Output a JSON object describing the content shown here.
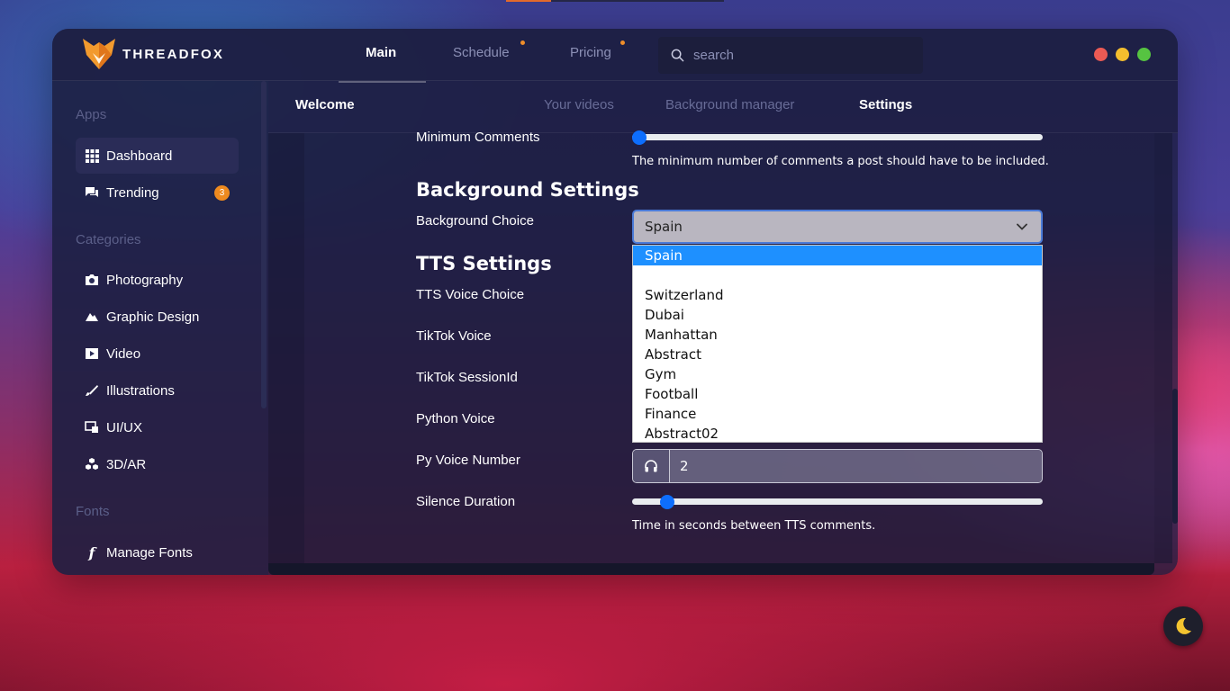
{
  "brand": {
    "name": "THREADFOX",
    "accent": "#ef8d2a"
  },
  "nav": {
    "tabs": [
      {
        "label": "Main",
        "active": true
      },
      {
        "label": "Schedule",
        "dot": true
      },
      {
        "label": "Pricing",
        "dot": true
      }
    ]
  },
  "search": {
    "placeholder": "search",
    "value": ""
  },
  "window_controls": {
    "close": "#ec5a54",
    "minimize": "#f4be2e",
    "maximize": "#56c341"
  },
  "sidebar": {
    "apps_heading": "Apps",
    "apps": [
      {
        "label": "Dashboard",
        "icon": "grid-icon",
        "active": true
      },
      {
        "label": "Trending",
        "icon": "chat-icon",
        "badge": "3"
      }
    ],
    "categories_heading": "Categories",
    "categories": [
      {
        "label": "Photography",
        "icon": "camera-icon"
      },
      {
        "label": "Graphic Design",
        "icon": "pen-nib-icon"
      },
      {
        "label": "Video",
        "icon": "video-icon"
      },
      {
        "label": "Illustrations",
        "icon": "brush-icon"
      },
      {
        "label": "UI/UX",
        "icon": "layout-icon"
      },
      {
        "label": "3D/AR",
        "icon": "cubes-icon"
      }
    ],
    "fonts_heading": "Fonts",
    "fonts": [
      {
        "label": "Manage Fonts",
        "icon": "font-f-icon"
      }
    ]
  },
  "subnav": {
    "welcome": "Welcome",
    "tabs": [
      {
        "label": "Your videos"
      },
      {
        "label": "Background manager"
      },
      {
        "label": "Settings",
        "active": true
      }
    ]
  },
  "settings": {
    "min_comments": {
      "label": "Minimum Comments",
      "help": "The minimum number of comments a post should have to be included.",
      "value_fraction": 0.0
    },
    "background_heading": "Background Settings",
    "background_choice": {
      "label": "Background Choice",
      "selected": "Spain",
      "options": [
        "Spain",
        "",
        "Switzerland",
        "Dubai",
        "Manhattan",
        "Abstract",
        "Gym",
        "Football",
        "Finance",
        "Abstract02"
      ]
    },
    "tts_heading": "TTS Settings",
    "tts_voice_choice": {
      "label": "TTS Voice Choice"
    },
    "tiktok_voice": {
      "label": "TikTok Voice"
    },
    "tiktok_session": {
      "label": "TikTok SessionId"
    },
    "python_voice": {
      "label": "Python Voice"
    },
    "py_voice_number": {
      "label": "Py Voice Number",
      "value": "2",
      "icon": "headphones-icon"
    },
    "silence_duration": {
      "label": "Silence Duration",
      "help": "Time in seconds between TTS comments.",
      "value_fraction": 0.07
    }
  },
  "theme_toggle": {
    "icon": "moon-icon",
    "color": "#f4c430"
  }
}
